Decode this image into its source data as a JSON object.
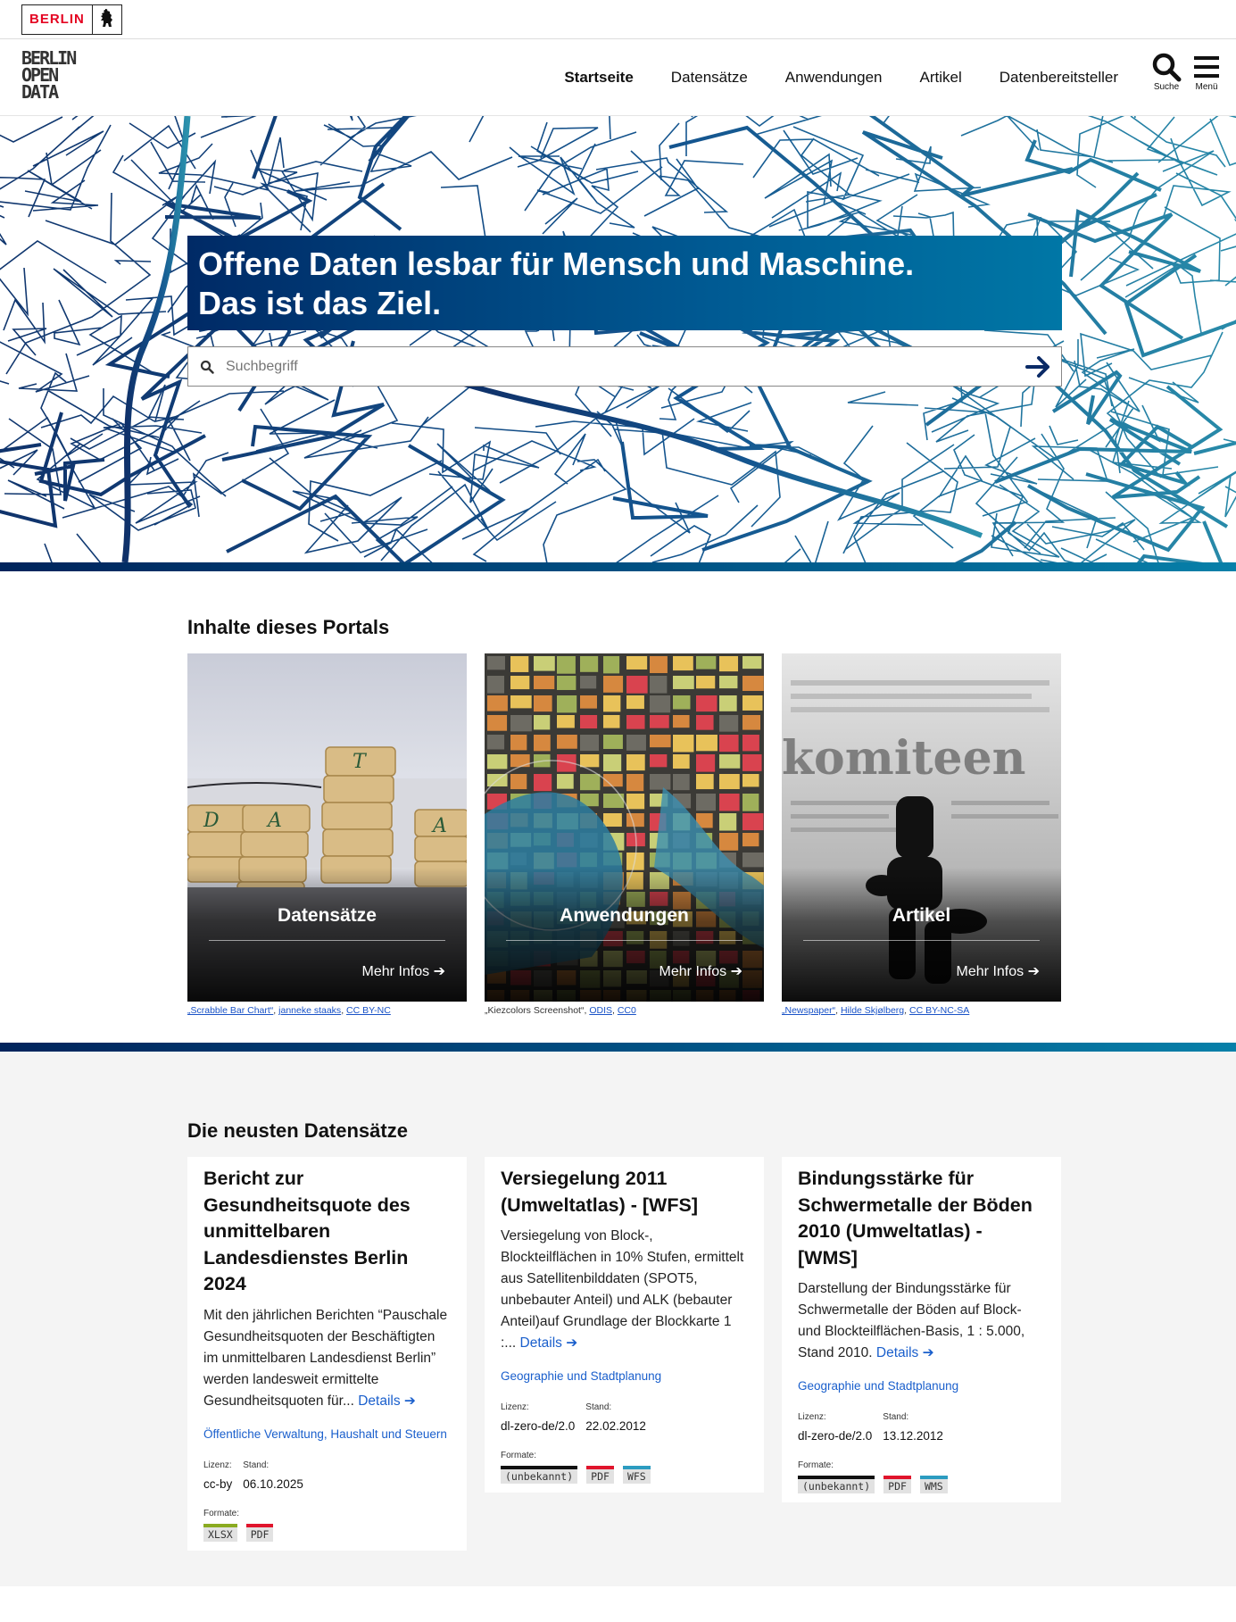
{
  "topbar": {
    "berlin_label": "BERLIN"
  },
  "header": {
    "logo_text": [
      "BERLIN",
      "OPEN",
      "DATA"
    ],
    "nav": [
      "Startseite",
      "Datensätze",
      "Anwendungen",
      "Artikel",
      "Datenbereitsteller"
    ],
    "search_label": "Suche",
    "menu_label": "Menü"
  },
  "hero": {
    "title_line1": "Offene Daten lesbar für Mensch und Maschine.",
    "title_line2": "Das ist das Ziel.",
    "search_placeholder": "Suchbegriff"
  },
  "portal": {
    "heading": "Inhalte dieses Portals",
    "tiles": [
      {
        "name": "Datensätze",
        "more": "Mehr Infos",
        "credit_title": "„Scrabble Bar Chart“",
        "credit_author": "janneke staaks",
        "credit_license": "CC BY-NC"
      },
      {
        "name": "Anwendungen",
        "more": "Mehr Infos",
        "credit_title": "„Kiezcolors Screenshot“",
        "credit_author": "ODIS",
        "credit_license": "CC0"
      },
      {
        "name": "Artikel",
        "more": "Mehr Infos",
        "credit_title": "„Newspaper“",
        "credit_author": "Hilde Skjølberg",
        "credit_license": "CC BY-NC-SA"
      }
    ]
  },
  "latest": {
    "heading": "Die neusten Datensätze",
    "details_label": "Details",
    "license_label": "Lizenz:",
    "date_label": "Stand:",
    "formats_label": "Formate:",
    "cards": [
      {
        "title": "Bericht zur Gesundheitsquote des unmittelbaren Landesdienstes Berlin 2024",
        "desc": "Mit den jährlichen Berichten “Pauschale Gesundheitsquoten der Beschäftigten im unmittelbaren Landesdienst Berlin” werden landesweit ermittelte Gesundheitsquoten für...",
        "category": "Öffentliche Verwaltung, Haushalt und Steuern",
        "license": "cc-by",
        "date": "06.10.2025",
        "formats": [
          {
            "label": "XLSX",
            "color": "#8aab21"
          },
          {
            "label": "PDF",
            "color": "#e0142c"
          }
        ]
      },
      {
        "title": "Versiegelung 2011 (Umweltatlas) - [WFS]",
        "desc": "Versiegelung von Block-, Blockteilflächen in 10% Stufen, ermittelt aus Satellitenbilddaten (SPOT5, unbebauter Anteil) und ALK (bebauter Anteil)auf Grundlage der Blockkarte 1 :...",
        "category": "Geographie und Stadtplanung",
        "license": "dl-zero-de/2.0",
        "date": "22.02.2012",
        "formats": [
          {
            "label": "(unbekannt)",
            "color": "#111111"
          },
          {
            "label": "PDF",
            "color": "#e0142c"
          },
          {
            "label": "WFS",
            "color": "#2c9cc0"
          }
        ]
      },
      {
        "title": "Bindungsstärke für Schwermetalle der Böden 2010 (Umweltatlas) - [WMS]",
        "desc": "Darstellung der Bindungsstärke für Schwermetalle der Böden auf Block- und Blockteilflächen-Basis, 1 : 5.000, Stand 2010.",
        "category": "Geographie und Stadtplanung",
        "license": "dl-zero-de/2.0",
        "date": "13.12.2012",
        "formats": [
          {
            "label": "(unbekannt)",
            "color": "#111111"
          },
          {
            "label": "PDF",
            "color": "#e0142c"
          },
          {
            "label": "WMS",
            "color": "#2c9cc0"
          }
        ]
      }
    ]
  }
}
